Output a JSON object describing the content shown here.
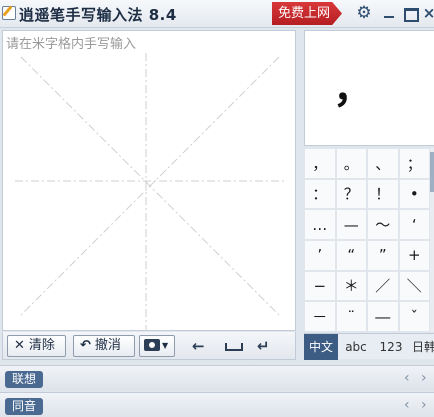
{
  "titlebar": {
    "title": "逍遥笔手写输入法 8.4",
    "online_label": "免费上网",
    "gear_icon": "gear-icon",
    "minimize": "–",
    "maximize": "",
    "close": "×"
  },
  "pad": {
    "hint": "请在米字格内手写输入"
  },
  "toolbar": {
    "clear_icon": "✕",
    "clear_label": "清除",
    "undo_icon": "↶",
    "undo_label": "撤消",
    "camera_caret": "▼",
    "backspace": "←",
    "enter": "↵"
  },
  "candidate": {
    "char": "，"
  },
  "symbols": [
    "，",
    "。",
    "、",
    "；",
    "：",
    "？",
    "！",
    "•",
    "…",
    "—",
    "～",
    "‘",
    "’",
    "“",
    "”",
    "+",
    "−",
    "＊",
    "／",
    "＼",
    "－",
    "¨",
    "―",
    "ˇ"
  ],
  "modes": [
    "中文",
    "abc",
    "123",
    "日韩"
  ],
  "bottom": {
    "assoc_label": "联想",
    "homo_label": "同音",
    "prev": "‹",
    "next": "›"
  },
  "colors": {
    "accent": "#3d5c84",
    "online_red": "#c42a2d",
    "guide_line": "#cfcfcf"
  }
}
